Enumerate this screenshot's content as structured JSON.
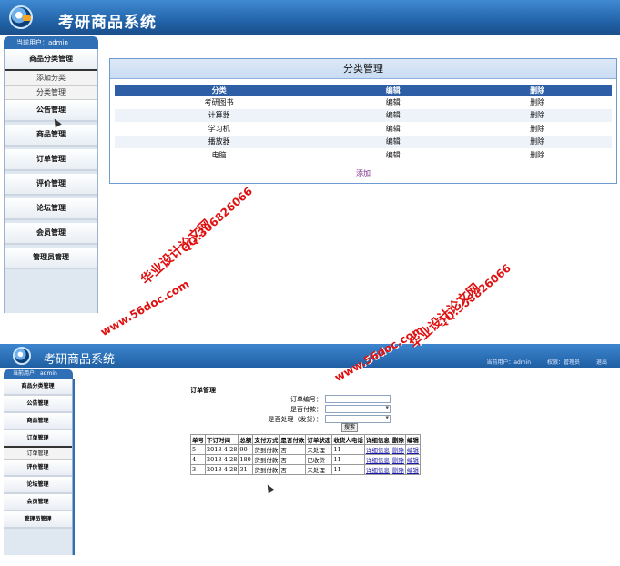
{
  "app_title": "考研商品系统",
  "shot1": {
    "current_user": "当前用户：admin",
    "menu": [
      {
        "label": "商品分类管理",
        "subs": [
          "添加分类",
          "分类管理"
        ]
      },
      {
        "label": "公告管理"
      },
      {
        "label": "商品管理"
      },
      {
        "label": "订单管理"
      },
      {
        "label": "评价管理"
      },
      {
        "label": "论坛管理"
      },
      {
        "label": "会员管理"
      },
      {
        "label": "管理员管理"
      }
    ],
    "page_title": "分类管理",
    "table_headers": [
      "分类",
      "编辑",
      "删除"
    ],
    "rows": [
      {
        "name": "考研图书",
        "edit": "编辑",
        "delete": "删除"
      },
      {
        "name": "计算器",
        "edit": "编辑",
        "delete": "删除"
      },
      {
        "name": "学习机",
        "edit": "编辑",
        "delete": "删除"
      },
      {
        "name": "播放器",
        "edit": "编辑",
        "delete": "删除"
      },
      {
        "name": "电脑",
        "edit": "编辑",
        "delete": "删除"
      }
    ],
    "add_link": "添加"
  },
  "watermark": {
    "site_text": "华业设计论文网",
    "qq_text": "QQ:306826066",
    "url_text": "www.56doc.com",
    "color": "#e01010"
  },
  "shot2": {
    "current_user": "当前用户：admin",
    "top_right": [
      "当前用户：admin",
      "权限：管理员",
      "退出"
    ],
    "menu": [
      {
        "label": "商品分类管理"
      },
      {
        "label": "公告管理"
      },
      {
        "label": "商品管理"
      },
      {
        "label": "订单管理",
        "subs": [
          "订单管理"
        ]
      },
      {
        "label": "评价管理"
      },
      {
        "label": "论坛管理"
      },
      {
        "label": "会员管理"
      },
      {
        "label": "管理员管理"
      }
    ],
    "page_title": "订单管理",
    "filters": {
      "order_no_label": "订单编号：",
      "paid_label": "是否付款：",
      "processed_label": "是否处理（发货）：",
      "search_button": "搜索"
    },
    "order_headers": [
      "单号",
      "下订时间",
      "总额",
      "支付方式",
      "是否付款",
      "订单状态",
      "收货人电话",
      "详细信息",
      "删除",
      "编辑"
    ],
    "orders": [
      {
        "id": "5",
        "date": "2013-4-28",
        "total": "90",
        "pay": "货到付款",
        "paid": "否",
        "status": "未处理",
        "phone": "11",
        "detail": "详细信息",
        "del": "删除",
        "edit": "编辑"
      },
      {
        "id": "4",
        "date": "2013-4-28",
        "total": "180",
        "pay": "货到付款",
        "paid": "否",
        "status": "已收货",
        "phone": "11",
        "detail": "详细信息",
        "del": "删除",
        "edit": "编辑"
      },
      {
        "id": "3",
        "date": "2013-4-28",
        "total": "31",
        "pay": "货到付款",
        "paid": "否",
        "status": "未处理",
        "phone": "11",
        "detail": "详细信息",
        "del": "删除",
        "edit": "编辑"
      }
    ]
  }
}
